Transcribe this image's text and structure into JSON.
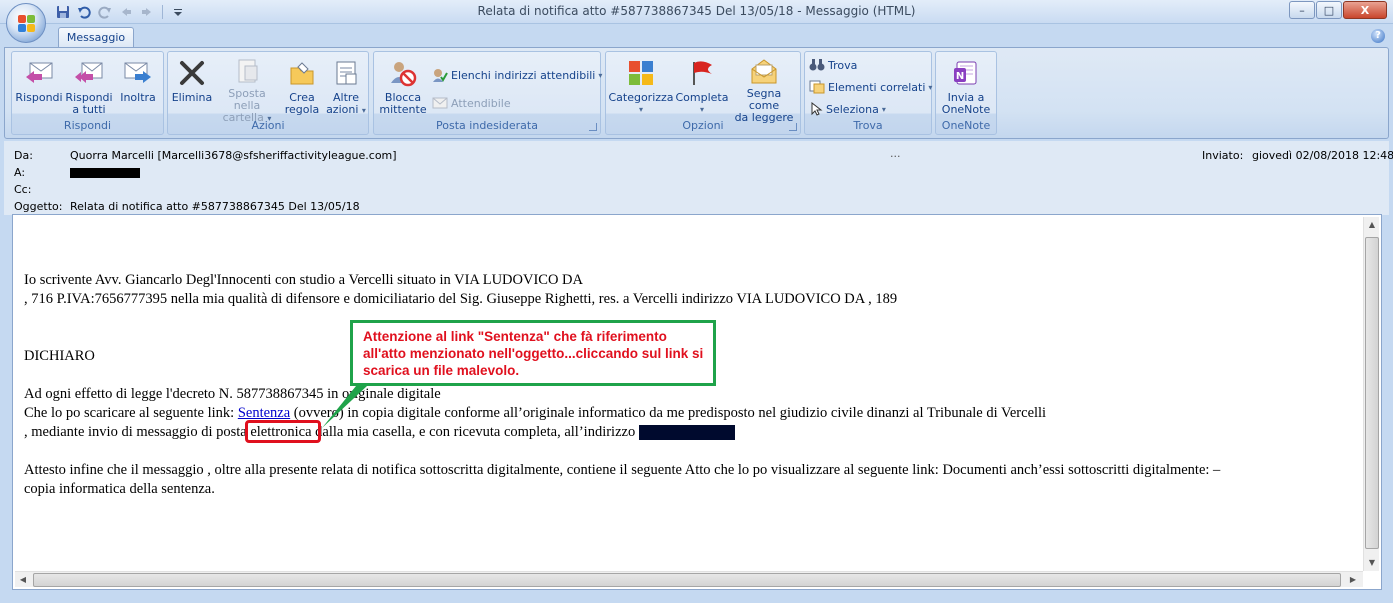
{
  "window": {
    "title": "Relata di notifica atto #587738867345 Del 13/05/18  -  Messaggio (HTML)",
    "controls": {
      "minimize": "–",
      "maximize": "□",
      "close": "X"
    }
  },
  "ribbon": {
    "tab": "Messaggio",
    "help": "?",
    "groups": {
      "rispondi": {
        "label": "Rispondi",
        "buttons": {
          "rispondi": [
            "Rispondi"
          ],
          "rispondi_tutti": [
            "Rispondi",
            "a tutti"
          ],
          "inoltra": [
            "Inoltra"
          ]
        }
      },
      "azioni": {
        "label": "Azioni",
        "buttons": {
          "elimina": [
            "Elimina"
          ],
          "sposta": [
            "Sposta nella",
            "cartella"
          ],
          "crea_regola": [
            "Crea",
            "regola"
          ],
          "altre_azioni": [
            "Altre",
            "azioni"
          ]
        }
      },
      "posta_indesiderata": {
        "label": "Posta indesiderata",
        "buttons": {
          "blocca": [
            "Blocca",
            "mittente"
          ],
          "elenchi": "Elenchi indirizzi attendibili",
          "attendibile": "Attendibile"
        }
      },
      "opzioni": {
        "label": "Opzioni",
        "buttons": {
          "categorizza": [
            "Categorizza"
          ],
          "completa": [
            "Completa"
          ],
          "segna": [
            "Segna come",
            "da leggere"
          ]
        }
      },
      "trova": {
        "label": "Trova",
        "buttons": {
          "trova": "Trova",
          "elementi": "Elementi correlati",
          "seleziona": "Seleziona"
        }
      },
      "onenote": {
        "label": "OneNote",
        "buttons": {
          "invia": [
            "Invia a",
            "OneNote"
          ]
        }
      }
    }
  },
  "message_header": {
    "from_label": "Da:",
    "from_value": "Quorra Marcelli [Marcelli3678@sfsheriffactivityleague.com]",
    "to_label": "A:",
    "cc_label": "Cc:",
    "subject_label": "Oggetto:",
    "subject_value": "Relata di notifica atto #587738867345 Del 13/05/18",
    "sent_label": "Inviato:",
    "sent_value": "giovedì 02/08/2018 12:48",
    "ellipsis": "..."
  },
  "message_body": {
    "line1": "Io scrivente Avv. Giancarlo Degl'Innocenti con studio a Vercelli  situato in VIA LUDOVICO DA",
    "line2": ", 716 P.IVA:7656777395  nella mia qualità di difensore e domiciliatario del Sig. Giuseppe Righetti, res. a Vercelli   indirizzo VIA LUDOVICO DA , 189",
    "dichiaro": "DICHIARO",
    "line3": "Ad  ogni effetto di  legge l'decreto N. 587738867345 in originale digitale",
    "line4_pre": "Che lo po scaricare al seguente link: ",
    "link_text": "Sentenza",
    "line4_post": " (ovvero) in copia digitale conforme all’originale informatico  da me predisposto nel giudizio civile dinanzi al Tribunale di Vercelli",
    "line5": ", mediante invio di messaggio di posta elettronica dalla mia casella, e con ricevuta completa, all’indirizzo ",
    "line6": "Attesto infine che il messaggio , oltre alla presente relata di notifica sottoscritta digitalmente, contiene il seguente Atto  che lo po visualizzare al seguente  link: Documenti  anch’essi sottoscritti  digitalmente: –",
    "line7": " copia informatica della sentenza."
  },
  "annotation": {
    "text": "Attenzione al link \"Sentenza\" che fà riferimento all'atto menzionato nell'oggetto...cliccando sul link si scarica un file malevolo.",
    "box_color": "#1fa34a",
    "text_color": "#e0101e",
    "highlight_color": "#e0101e"
  },
  "icons": {
    "office": "office-logo-icon",
    "save": "save-icon",
    "undo": "undo-icon",
    "redo": "redo-icon"
  }
}
